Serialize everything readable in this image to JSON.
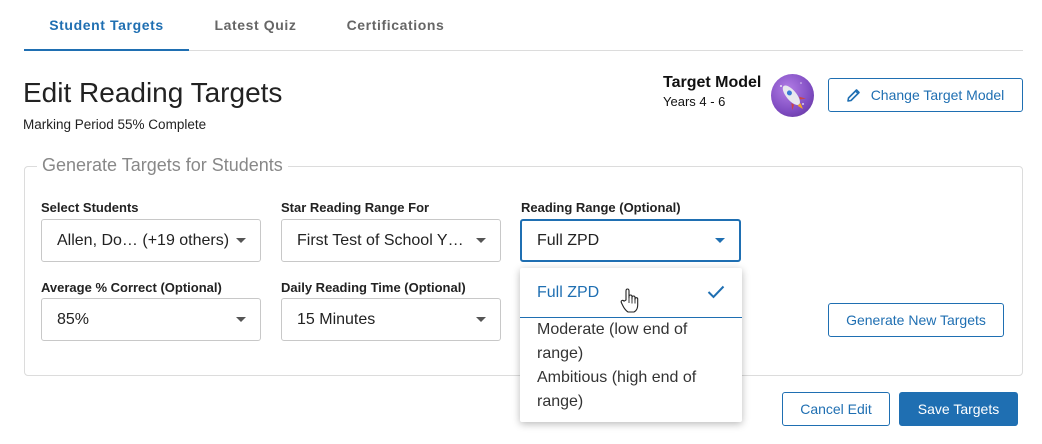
{
  "tabs": [
    {
      "label": "Student Targets",
      "active": true
    },
    {
      "label": "Latest Quiz",
      "active": false
    },
    {
      "label": "Certifications",
      "active": false
    }
  ],
  "header": {
    "title": "Edit Reading Targets",
    "subtitle": "Marking Period 55% Complete"
  },
  "target_model": {
    "title": "Target Model",
    "years": "Years 4 - 6",
    "avatar_icon": "rocket-icon",
    "change_label": "Change Target Model"
  },
  "generate": {
    "legend": "Generate Targets for Students",
    "fields": {
      "students": {
        "label": "Select Students",
        "value": "Allen, Do… (+19 others)"
      },
      "star_range": {
        "label": "Star Reading Range For",
        "value": "First Test of School Y…"
      },
      "reading_range": {
        "label": "Reading Range (Optional)",
        "value": "Full ZPD"
      },
      "avg_correct": {
        "label": "Average % Correct (Optional)",
        "value": "85%"
      },
      "daily_time": {
        "label": "Daily Reading Time (Optional)",
        "value": "15 Minutes"
      }
    },
    "dropdown_options": [
      {
        "label": "Full ZPD",
        "selected": true
      },
      {
        "label": "Moderate (low end of range)",
        "selected": false
      },
      {
        "label": "Ambitious (high end of range)",
        "selected": false
      }
    ],
    "generate_label": "Generate New Targets"
  },
  "actions": {
    "cancel_label": "Cancel Edit",
    "save_label": "Save Targets"
  },
  "colors": {
    "accent": "#1f6fb2",
    "border": "#c8c8c8"
  }
}
